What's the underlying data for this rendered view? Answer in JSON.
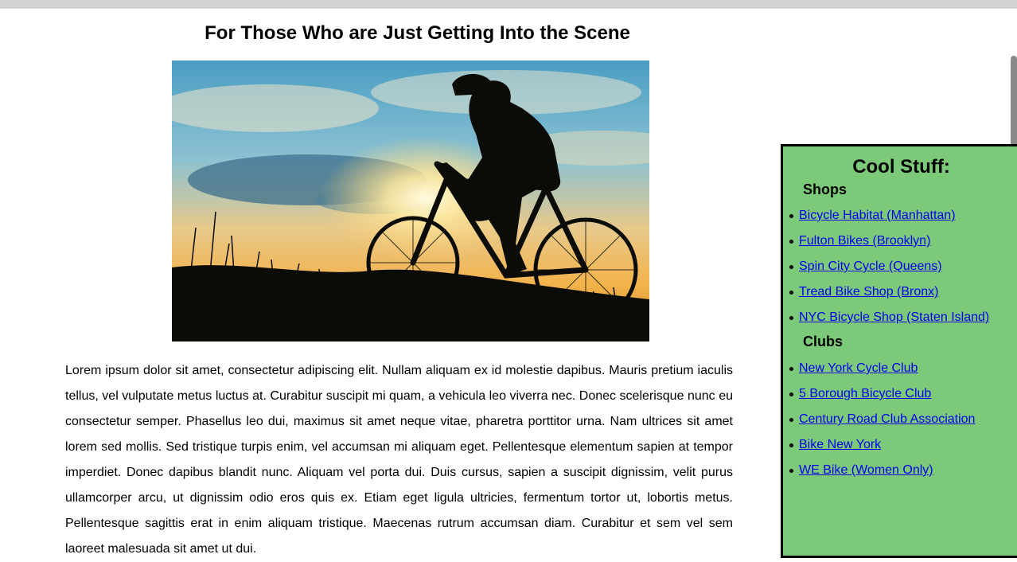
{
  "main": {
    "title": "For Those Who are Just Getting Into the Scene",
    "body_text": "Lorem ipsum dolor sit amet, consectetur adipiscing elit. Nullam aliquam ex id molestie dapibus. Mauris pretium iaculis tellus, vel vulputate metus luctus at. Curabitur suscipit mi quam, a vehicula leo viverra nec. Donec scelerisque nunc eu consectetur semper. Phasellus leo dui, maximus sit amet neque vitae, pharetra porttitor urna. Nam ultrices sit amet lorem sed mollis. Sed tristique turpis enim, vel accumsan mi aliquam eget. Pellentesque elementum sapien at tempor imperdiet. Donec dapibus blandit nunc. Aliquam vel porta dui. Duis cursus, sapien a suscipit dignissim, velit purus ullamcorper arcu, ut dignissim odio eros quis ex. Etiam eget ligula ultricies, fermentum tortor ut, lobortis metus. Pellentesque sagittis erat in enim aliquam tristique. Maecenas rutrum accumsan diam. Curabitur et sem vel sem laoreet malesuada sit amet ut dui."
  },
  "sidebar": {
    "title": "Cool Stuff:",
    "shops": {
      "heading": "Shops",
      "items": [
        {
          "label": "Bicycle Habitat (Manhattan)"
        },
        {
          "label": "Fulton Bikes (Brooklyn)"
        },
        {
          "label": "Spin City Cycle (Queens)"
        },
        {
          "label": "Tread Bike Shop (Bronx)"
        },
        {
          "label": "NYC Bicycle Shop (Staten Island)"
        }
      ]
    },
    "clubs": {
      "heading": "Clubs",
      "items": [
        {
          "label": "New York Cycle Club"
        },
        {
          "label": "5 Borough Bicycle Club"
        },
        {
          "label": "Century Road Club Association"
        },
        {
          "label": "Bike New York"
        },
        {
          "label": "WE Bike (Women Only)"
        }
      ]
    },
    "colors": {
      "background": "#7dc97a",
      "link": "#0000ee",
      "border": "#000000"
    }
  }
}
